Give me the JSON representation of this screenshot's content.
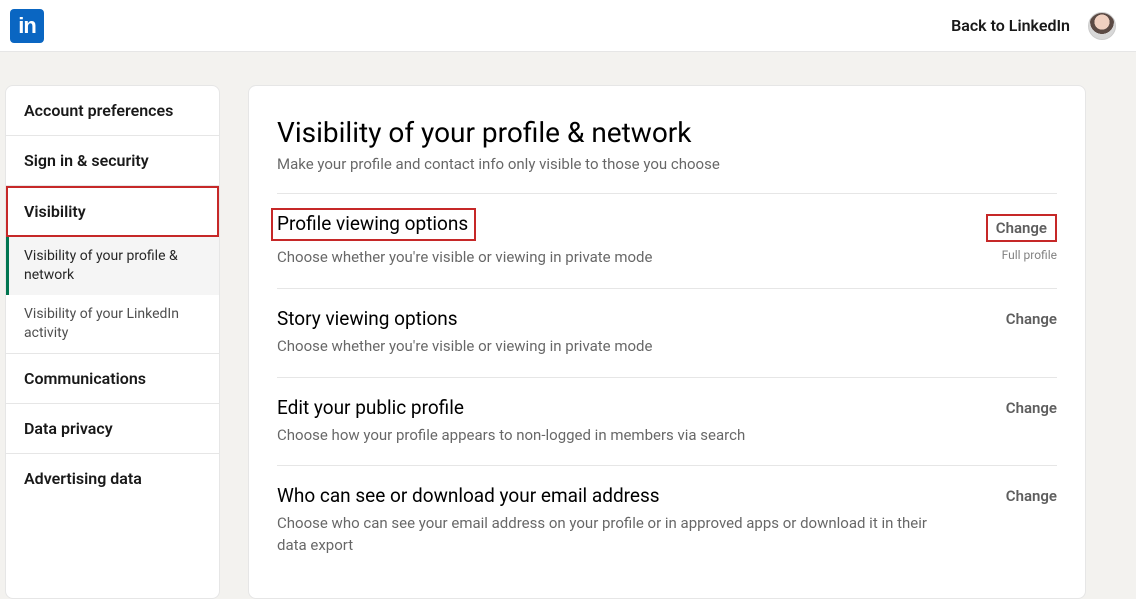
{
  "header": {
    "logo_text": "in",
    "back_label": "Back to LinkedIn"
  },
  "sidebar": {
    "items": [
      {
        "label": "Account preferences"
      },
      {
        "label": "Sign in & security"
      },
      {
        "label": "Visibility"
      },
      {
        "label": "Communications"
      },
      {
        "label": "Data privacy"
      },
      {
        "label": "Advertising data"
      }
    ],
    "sub_items": [
      {
        "label": "Visibility of your profile & network"
      },
      {
        "label": "Visibility of your LinkedIn activity"
      }
    ]
  },
  "main": {
    "title": "Visibility of your profile & network",
    "subtitle": "Make your profile and contact info only visible to those you choose",
    "settings": [
      {
        "title": "Profile viewing options",
        "desc": "Choose whether you're visible or viewing in private mode",
        "action": "Change",
        "status": "Full profile"
      },
      {
        "title": "Story viewing options",
        "desc": "Choose whether you're visible or viewing in private mode",
        "action": "Change"
      },
      {
        "title": "Edit your public profile",
        "desc": "Choose how your profile appears to non-logged in members via search",
        "action": "Change"
      },
      {
        "title": "Who can see or download your email address",
        "desc": "Choose who can see your email address on your profile or in approved apps or download it in their data export",
        "action": "Change"
      }
    ]
  }
}
